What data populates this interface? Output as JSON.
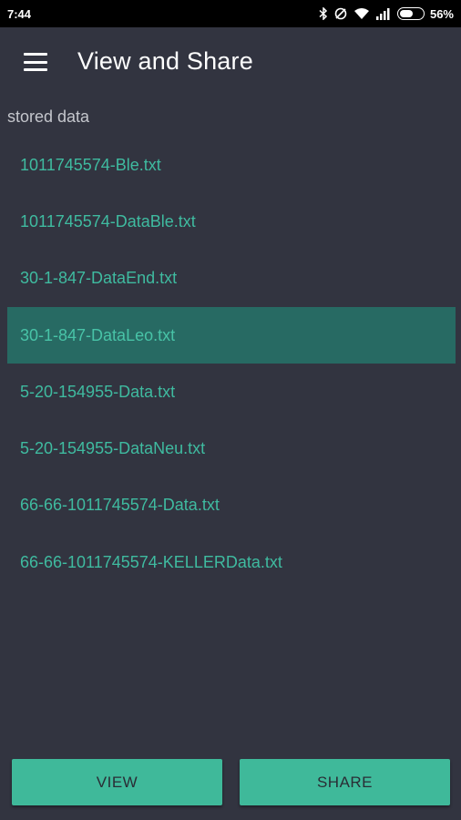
{
  "status_bar": {
    "time": "7:44",
    "battery": "56%",
    "icons": [
      "bluetooth-icon",
      "data-saver-icon",
      "wifi-icon",
      "signal-icon",
      "battery-icon"
    ]
  },
  "app_bar": {
    "title": "View and Share",
    "menu_icon": "menu-icon"
  },
  "list": {
    "label": "stored data",
    "selected_index": 3,
    "items": [
      {
        "name": "1011745574-Ble.txt"
      },
      {
        "name": "1011745574-DataBle.txt"
      },
      {
        "name": "30-1-847-DataEnd.txt"
      },
      {
        "name": "30-1-847-DataLeo.txt"
      },
      {
        "name": "5-20-154955-Data.txt"
      },
      {
        "name": "5-20-154955-DataNeu.txt"
      },
      {
        "name": "66-66-1011745574-Data.txt"
      },
      {
        "name": "66-66-1011745574-KELLERData.txt"
      }
    ]
  },
  "buttons": {
    "view_label": "VIEW",
    "share_label": "SHARE"
  },
  "colors": {
    "background": "#323440",
    "accent": "#3fb99a",
    "selected_row": "#276a63",
    "item_text": "#3fbba0"
  }
}
